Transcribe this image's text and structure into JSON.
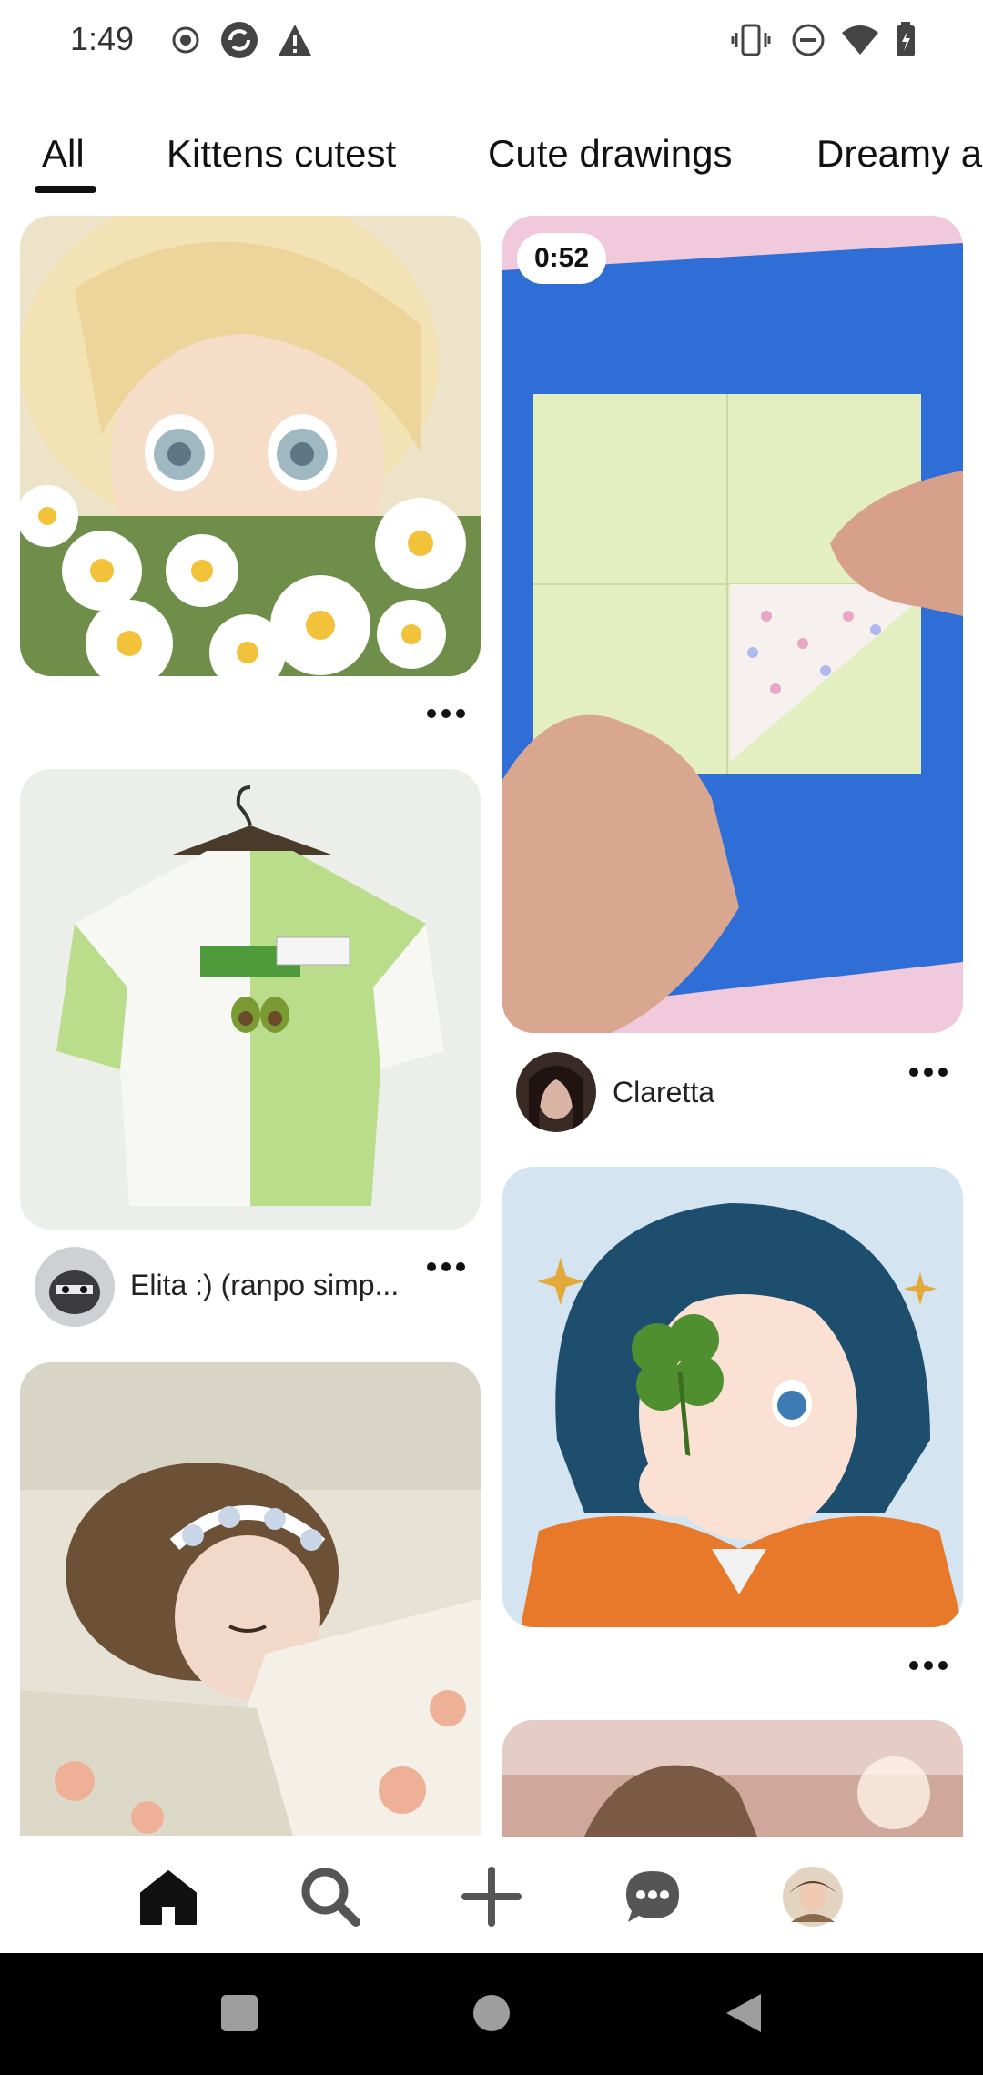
{
  "status_bar": {
    "time": "1:49",
    "left_icons": [
      "record-icon",
      "sync-icon",
      "warning-icon"
    ],
    "right_icons": [
      "vibrate-icon",
      "do-not-disturb-icon",
      "wifi-icon",
      "battery-icon"
    ]
  },
  "tabs": [
    {
      "label": "All",
      "selected": true
    },
    {
      "label": "Kittens cutest",
      "selected": false
    },
    {
      "label": "Cute drawings",
      "selected": false
    },
    {
      "label": "Dreamy a",
      "selected": false
    }
  ],
  "feed": {
    "left_column": [
      {
        "kind": "image",
        "subject": "anime girl with daisies",
        "creator": ""
      },
      {
        "kind": "image",
        "subject": "avocado t-shirt",
        "creator": "Elita :) (ranpo simp..."
      },
      {
        "kind": "image",
        "subject": "sleeping girl among roses",
        "creator": ""
      }
    ],
    "right_column": [
      {
        "kind": "video",
        "subject": "paper folding",
        "duration": "0:52",
        "creator": "Claretta"
      },
      {
        "kind": "image",
        "subject": "girl with four-leaf clover",
        "creator": ""
      },
      {
        "kind": "image",
        "subject": "sunset portrait",
        "creator": ""
      }
    ]
  },
  "bottom_nav": [
    {
      "icon": "home-icon",
      "active": true
    },
    {
      "icon": "search-icon",
      "active": false
    },
    {
      "icon": "plus-icon",
      "active": false
    },
    {
      "icon": "chat-icon",
      "active": false
    },
    {
      "icon": "profile-avatar",
      "active": false
    }
  ],
  "system_nav": [
    "recents-icon",
    "home-circle-icon",
    "back-icon"
  ],
  "colors": {
    "text": "#111111",
    "background": "#ffffff",
    "video_bg": "#2f6ed6"
  }
}
